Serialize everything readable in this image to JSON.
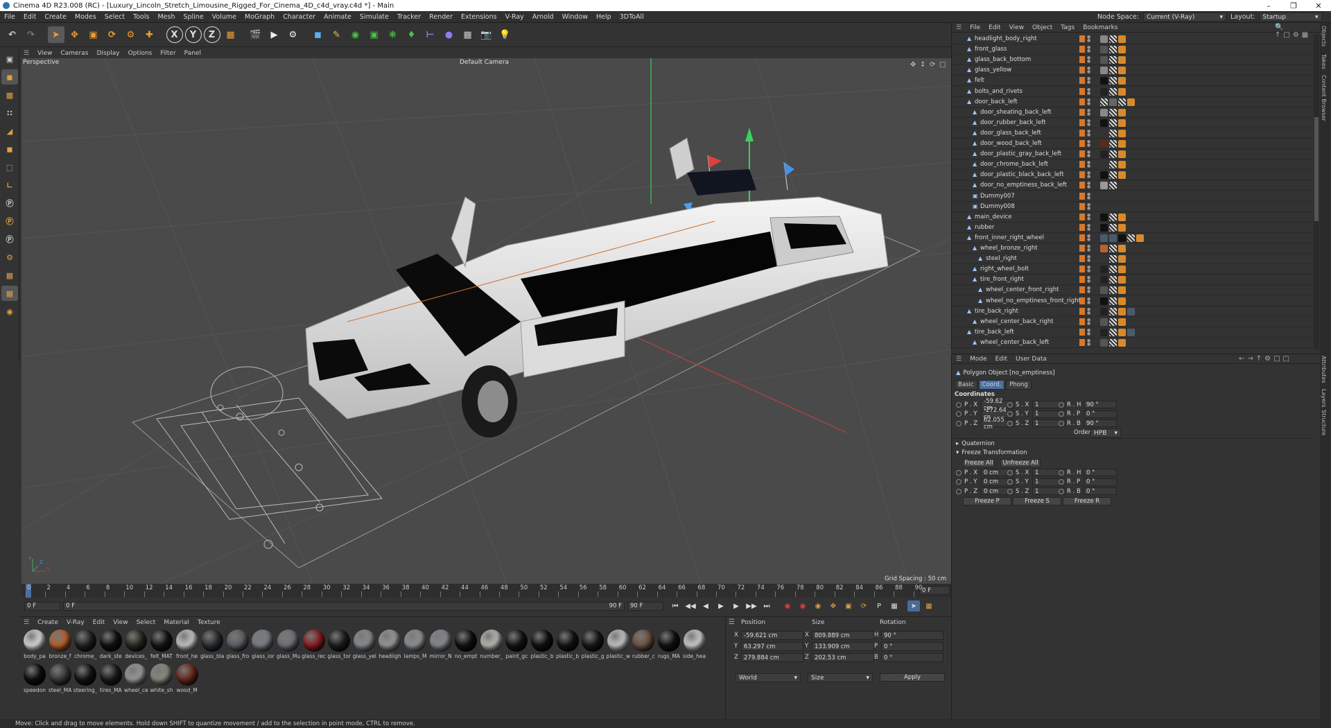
{
  "window": {
    "title": "Cinema 4D R23.008 (RC) - [Luxury_Lincoln_Stretch_Limousine_Rigged_For_Cinema_4D_c4d_vray.c4d *] - Main"
  },
  "menu": [
    "File",
    "Edit",
    "Create",
    "Modes",
    "Select",
    "Tools",
    "Mesh",
    "Spline",
    "Volume",
    "MoGraph",
    "Character",
    "Animate",
    "Simulate",
    "Tracker",
    "Render",
    "Extensions",
    "V-Ray",
    "Arnold",
    "Window",
    "Help",
    "3DToAll"
  ],
  "node_space": {
    "label": "Node Space:",
    "value": "Current (V-Ray)"
  },
  "layout": {
    "label": "Layout:",
    "value": "Startup"
  },
  "viewport": {
    "menu": [
      "View",
      "Cameras",
      "Display",
      "Options",
      "Filter",
      "Panel"
    ],
    "name": "Perspective",
    "camera": "Default Camera",
    "grid_spacing": "Grid Spacing : 50 cm",
    "axis_labels": {
      "x": "X",
      "y": "Y",
      "z": "Z"
    }
  },
  "timeline": {
    "ticks": [
      "0",
      "2",
      "4",
      "6",
      "8",
      "10",
      "12",
      "14",
      "16",
      "18",
      "20",
      "22",
      "24",
      "26",
      "28",
      "30",
      "32",
      "34",
      "36",
      "38",
      "40",
      "42",
      "44",
      "46",
      "48",
      "50",
      "52",
      "54",
      "56",
      "58",
      "60",
      "62",
      "64",
      "66",
      "68",
      "70",
      "72",
      "74",
      "76",
      "78",
      "80",
      "82",
      "84",
      "86",
      "88",
      "90"
    ],
    "current_frame": "0 F"
  },
  "transport": {
    "start": "0 F",
    "current": "0 F",
    "end": "90 F",
    "end2": "90 F"
  },
  "materials": {
    "menu": [
      "Create",
      "V-Ray",
      "Edit",
      "View",
      "Select",
      "Material",
      "Texture"
    ],
    "items": [
      {
        "name": "body_pa",
        "color": "#dcdcdc"
      },
      {
        "name": "bronze_f",
        "color": "#b8622e"
      },
      {
        "name": "chrome_",
        "color": "#222222"
      },
      {
        "name": "dark_ste",
        "color": "#111111"
      },
      {
        "name": "devices_",
        "color": "#2a2a22"
      },
      {
        "name": "felt_MAT",
        "color": "#151515"
      },
      {
        "name": "front_he",
        "color": "#c8c8c8"
      },
      {
        "name": "glass_bla",
        "color": "#2b2f33"
      },
      {
        "name": "glass_fro",
        "color": "#5c6166"
      },
      {
        "name": "glass_ior",
        "color": "#7a7f84"
      },
      {
        "name": "glass_Mu",
        "color": "#6f7479"
      },
      {
        "name": "glass_rec",
        "color": "#8a1d22"
      },
      {
        "name": "glass_tor",
        "color": "#1b1e21"
      },
      {
        "name": "glass_yel",
        "color": "#8b8f93"
      },
      {
        "name": "headligh",
        "color": "#9a9a9a"
      },
      {
        "name": "lamps_M",
        "color": "#8f9498"
      },
      {
        "name": "mirror_N",
        "color": "#888c90"
      },
      {
        "name": "no_empt",
        "color": "#111111"
      },
      {
        "name": "number_",
        "color": "#bdbdb5"
      },
      {
        "name": "paint_gc",
        "color": "#151515"
      },
      {
        "name": "plastic_b",
        "color": "#101010"
      },
      {
        "name": "plastic_b",
        "color": "#141414"
      },
      {
        "name": "plastic_g",
        "color": "#181818"
      },
      {
        "name": "plastic_w",
        "color": "#c9c9c9"
      },
      {
        "name": "rubber_c",
        "color": "#6e5443"
      },
      {
        "name": "rugs_MA",
        "color": "#121212"
      },
      {
        "name": "side_hea",
        "color": "#d0d0d0"
      },
      {
        "name": "speedon",
        "color": "#0e0e0e"
      },
      {
        "name": "steel_MA",
        "color": "#3a3a3a"
      },
      {
        "name": "steering_",
        "color": "#141414"
      },
      {
        "name": "tires_MA",
        "color": "#1c1c1c"
      },
      {
        "name": "wheel_ce",
        "color": "#9b9b9b"
      },
      {
        "name": "white_sh",
        "color": "#8c8a80"
      },
      {
        "name": "wood_M",
        "color": "#6a2a1c"
      }
    ]
  },
  "coords": {
    "headers": [
      "Position",
      "Size",
      "Rotation"
    ],
    "rows": [
      {
        "axis": "X",
        "pos": "-59.621 cm",
        "size_axis": "X",
        "size": "809.889 cm",
        "rot_axis": "H",
        "rot": "90 °"
      },
      {
        "axis": "Y",
        "pos": "63.297 cm",
        "size_axis": "Y",
        "size": "133.909 cm",
        "rot_axis": "P",
        "rot": "0 °"
      },
      {
        "axis": "Z",
        "pos": "279.884 cm",
        "size_axis": "Z",
        "size": "202.53 cm",
        "rot_axis": "B",
        "rot": "0 °"
      }
    ],
    "mode": "World",
    "size_mode": "Size",
    "apply": "Apply"
  },
  "status": "Move: Click and drag to move elements. Hold down SHIFT to quantize movement / add to the selection in point mode, CTRL to remove.",
  "objects": {
    "menu": [
      "File",
      "Edit",
      "View",
      "Object",
      "Tags",
      "Bookmarks"
    ],
    "rows": [
      {
        "name": "headlight_body_right",
        "indent": 1,
        "tags": [
          "#888",
          "#777",
          "#d88a2a"
        ]
      },
      {
        "name": "front_glass",
        "indent": 1,
        "tags": [
          "#555",
          "#777",
          "#d88a2a"
        ]
      },
      {
        "name": "glass_back_bottom",
        "indent": 1,
        "tags": [
          "#555",
          "#777",
          "#d88a2a"
        ]
      },
      {
        "name": "glass_yellow",
        "indent": 1,
        "tags": [
          "#888",
          "#777",
          "#d88a2a"
        ]
      },
      {
        "name": "felt",
        "indent": 1,
        "tags": [
          "#111",
          "#777",
          "#d88a2a"
        ]
      },
      {
        "name": "bolts_and_rivets",
        "indent": 1,
        "tags": [
          "#222",
          "#777",
          "#d88a2a"
        ]
      },
      {
        "name": "door_back_left",
        "indent": 1,
        "tags": [
          "#777",
          "#666",
          "#777",
          "#d88a2a"
        ]
      },
      {
        "name": "door_sheating_back_left",
        "indent": 2,
        "tags": [
          "#888",
          "#777",
          "#d88a2a"
        ]
      },
      {
        "name": "door_rubber_back_left",
        "indent": 2,
        "tags": [
          "#111",
          "#777",
          "#d88a2a"
        ]
      },
      {
        "name": "door_glass_back_left",
        "indent": 2,
        "tags": [
          "#333",
          "#777",
          "#d88a2a"
        ]
      },
      {
        "name": "door_wood_back_left",
        "indent": 2,
        "tags": [
          "#5a2a1c",
          "#777",
          "#d88a2a"
        ]
      },
      {
        "name": "door_plastic_gray_back_left",
        "indent": 2,
        "tags": [
          "#222",
          "#777",
          "#d88a2a"
        ]
      },
      {
        "name": "door_chrome_back_left",
        "indent": 2,
        "tags": [
          "#333",
          "#777",
          "#d88a2a"
        ]
      },
      {
        "name": "door_plastic_black_back_left",
        "indent": 2,
        "tags": [
          "#111",
          "#777",
          "#d88a2a"
        ]
      },
      {
        "name": "door_no_emptiness_back_left",
        "indent": 2,
        "tags": [
          "#999",
          "#777"
        ]
      },
      {
        "name": "Dummy007",
        "indent": 2,
        "tags": []
      },
      {
        "name": "Dummy008",
        "indent": 2,
        "tags": []
      },
      {
        "name": "main_device",
        "indent": 1,
        "tags": [
          "#111",
          "#777",
          "#d88a2a"
        ]
      },
      {
        "name": "rubber",
        "indent": 1,
        "tags": [
          "#111",
          "#777",
          "#d88a2a"
        ]
      },
      {
        "name": "front_inner_right_wheel",
        "indent": 1,
        "tags": [
          "#4a5a6a",
          "#4a5a6a",
          "#111",
          "#777",
          "#d88a2a"
        ]
      },
      {
        "name": "wheel_bronze_right",
        "indent": 2,
        "tags": [
          "#b8622e",
          "#777",
          "#d88a2a"
        ]
      },
      {
        "name": "steel_right",
        "indent": 3,
        "tags": [
          "#333",
          "#777",
          "#d88a2a"
        ]
      },
      {
        "name": "right_wheel_bolt",
        "indent": 2,
        "tags": [
          "#222",
          "#777",
          "#d88a2a"
        ]
      },
      {
        "name": "tire_front_right",
        "indent": 2,
        "tags": [
          "#222",
          "#777",
          "#d88a2a"
        ]
      },
      {
        "name": "wheel_center_front_right",
        "indent": 3,
        "tags": [
          "#555",
          "#777",
          "#d88a2a"
        ]
      },
      {
        "name": "wheel_no_emptiness_front_right",
        "indent": 3,
        "tags": [
          "#111",
          "#777",
          "#d88a2a"
        ]
      },
      {
        "name": "tire_back_right",
        "indent": 1,
        "tags": [
          "#222",
          "#777",
          "#d88a2a",
          "#4a5a6a"
        ]
      },
      {
        "name": "wheel_center_back_right",
        "indent": 2,
        "tags": [
          "#555",
          "#777",
          "#d88a2a"
        ]
      },
      {
        "name": "tire_back_left",
        "indent": 1,
        "tags": [
          "#222",
          "#777",
          "#d88a2a",
          "#4a5a6a"
        ]
      },
      {
        "name": "wheel_center_back_left",
        "indent": 2,
        "tags": [
          "#555",
          "#777",
          "#d88a2a"
        ]
      }
    ]
  },
  "side_tabs": [
    "Objects",
    "Takes",
    "Content Browser"
  ],
  "side_tabs2": [
    "Attributes",
    "Layers",
    "Structure"
  ],
  "attributes": {
    "menu": [
      "Mode",
      "Edit",
      "User Data"
    ],
    "object": "Polygon Object [no_emptiness]",
    "tabs": [
      "Basic",
      "Coord.",
      "Phong"
    ],
    "active_tab": "Coord.",
    "section": "Coordinates",
    "coords": [
      {
        "p_label": "P . X",
        "p": "-59.62 cm",
        "s_label": "S . X",
        "s": "1",
        "r_label": "R . H",
        "r": "90 °"
      },
      {
        "p_label": "P . Y",
        "p": "-272.64 cn",
        "s_label": "S . Y",
        "s": "1",
        "r_label": "R . P",
        "r": "0 °"
      },
      {
        "p_label": "P . Z",
        "p": "62.055 cm",
        "s_label": "S . Z",
        "s": "1",
        "r_label": "R . B",
        "r": "90 °"
      }
    ],
    "order_label": "Order",
    "order": "HPB",
    "quaternion": "Quaternion",
    "freeze_section": "Freeze Transformation",
    "freeze_all": "Freeze All",
    "unfreeze_all": "Unfreeze All",
    "freeze_coords": [
      {
        "p_label": "P . X",
        "p": "0 cm",
        "s_label": "S . X",
        "s": "1",
        "r_label": "R . H",
        "r": "0 °"
      },
      {
        "p_label": "P . Y",
        "p": "0 cm",
        "s_label": "S . Y",
        "s": "1",
        "r_label": "R . P",
        "r": "0 °"
      },
      {
        "p_label": "P . Z",
        "p": "0 cm",
        "s_label": "S . Z",
        "s": "1",
        "r_label": "R . B",
        "r": "0 °"
      }
    ],
    "freeze_p": "Freeze P",
    "freeze_s": "Freeze S",
    "freeze_r": "Freeze R"
  }
}
